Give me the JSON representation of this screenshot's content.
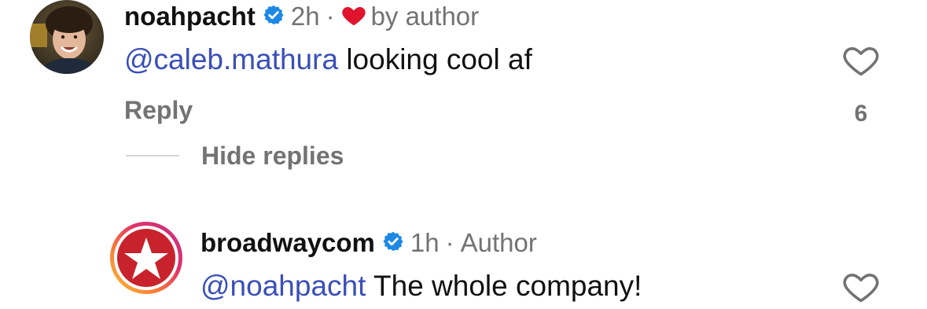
{
  "comments": [
    {
      "username": "noahpacht",
      "verified": true,
      "time": "2h",
      "liked_by_author_label": "by author",
      "mention": "@caleb.mathura",
      "text": "looking cool af",
      "reply_label": "Reply",
      "like_count": "6",
      "hide_replies_label": "Hide replies"
    },
    {
      "username": "broadwaycom",
      "verified": true,
      "time": "1h",
      "role_label": "Author",
      "mention": "@noahpacht",
      "text": "The whole company!"
    }
  ],
  "colors": {
    "mention": "#3a4fb8",
    "verified": "#1e88e5",
    "heart": "#e0142c",
    "muted": "#737373"
  },
  "icons": [
    "verified-badge-icon",
    "heart-filled-icon",
    "heart-outline-icon",
    "star-logo-icon"
  ]
}
